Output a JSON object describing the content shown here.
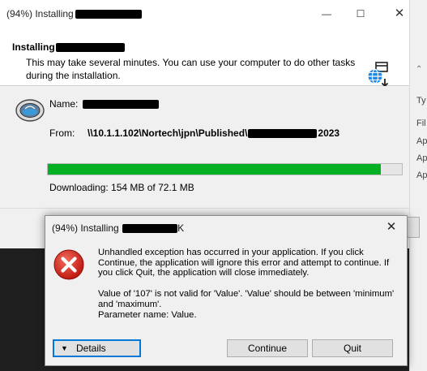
{
  "installer": {
    "title": "(94%) Installing",
    "heading": "Installing",
    "description": "This may take several minutes. You can use your computer to do other tasks during the installation.",
    "name_label": "Name:",
    "from_label": "From:",
    "from_value_prefix": "\\\\10.1.1.102\\Nortech\\jpn\\Published\\",
    "from_value_suffix": "2023",
    "progress_fraction": 0.94,
    "downloading_text": "Downloading: 154 MB of 72.1 MB"
  },
  "error_dialog": {
    "title": "(94%) Installing",
    "title_suffix": "K",
    "message_line1": "Unhandled exception has occurred in your application. If you click Continue, the application will ignore this error and attempt to continue. If you click Quit, the application will close immediately.",
    "message_line2": "Value of '107' is not valid for 'Value'. 'Value' should be between 'minimum' and 'maximum'.",
    "message_line3": "Parameter name: Value.",
    "details_label": "Details",
    "continue_label": "Continue",
    "quit_label": "Quit"
  },
  "background_window": {
    "labels": [
      "Ty",
      "Fil",
      "Ap",
      "Ap",
      "Ap"
    ]
  },
  "colors": {
    "progress": "#06b025",
    "error_red": "#d9251d",
    "focus_blue": "#0078d7"
  },
  "icons": [
    "globe-download-icon",
    "app-logo-icon",
    "error-icon",
    "close-icon",
    "minimize-icon",
    "maximize-icon",
    "chevron-down-icon"
  ]
}
